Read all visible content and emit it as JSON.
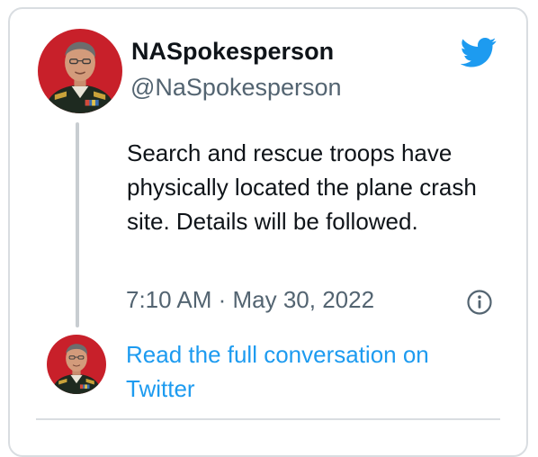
{
  "tweet": {
    "display_name": "NASpokesperson",
    "handle": "@NaSpokesperson",
    "text": "Search and rescue troops have physically located the plane crash site. Details will be followed.",
    "timestamp": "7:10 AM · May 30, 2022",
    "read_more": "Read the full conversation on Twitter"
  },
  "icons": {
    "brand": "twitter-bird-icon",
    "info": "info-icon"
  },
  "colors": {
    "accent": "#1d9bf0",
    "text_primary": "#0f1419",
    "text_secondary": "#536471",
    "border": "#d9dde1",
    "avatar_background": "#c8202a",
    "uniform": "#1e2a20"
  }
}
